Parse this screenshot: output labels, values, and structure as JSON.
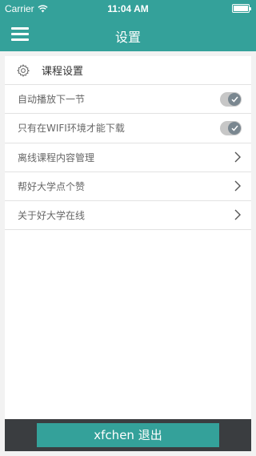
{
  "status": {
    "carrier": "Carrier",
    "time": "11:04 AM"
  },
  "nav": {
    "title": "设置"
  },
  "section": {
    "title": "课程设置"
  },
  "settings": {
    "autoplay": {
      "label": "自动播放下一节",
      "enabled": true
    },
    "wifi_only": {
      "label": "只有在WIFI环境才能下载",
      "enabled": true
    }
  },
  "menu": {
    "offline": "离线课程内容管理",
    "like": "帮好大学点个赞",
    "about": "关于好大学在线"
  },
  "footer": {
    "logout_label": "xfchen 退出"
  },
  "colors": {
    "accent": "#34a19a",
    "footer_bg": "#3a3d40",
    "toggle": "#7a8790"
  }
}
